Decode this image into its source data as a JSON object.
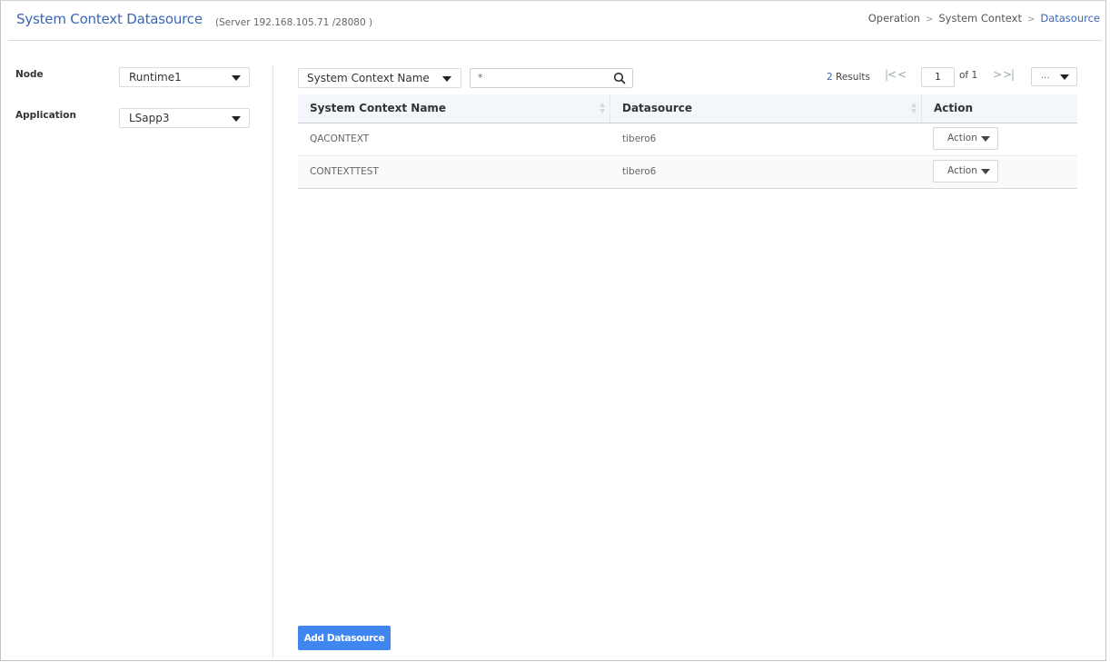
{
  "header": {
    "title": "System Context Datasource",
    "server_info": "(Server 192.168.105.71 /28080 )",
    "breadcrumb": [
      "Operation",
      "System Context",
      "Datasource"
    ]
  },
  "filters": {
    "node": {
      "label": "Node",
      "value": "Runtime1"
    },
    "application": {
      "label": "Application",
      "value": "LSapp3"
    }
  },
  "toolbar": {
    "search_field_select": "System Context Name",
    "search_value": "*",
    "results_count": "2",
    "results_label": "Results",
    "first_page_icon": "|<",
    "prev_page_icon": "<",
    "current_page": "1",
    "page_of": "of 1",
    "next_page_icon": ">",
    "last_page_icon": ">|",
    "more_label": "..."
  },
  "table": {
    "columns": [
      "System Context Name",
      "Datasource",
      "Action"
    ],
    "rows": [
      {
        "name": "QACONTEXT",
        "datasource": "tibero6",
        "action": "Action"
      },
      {
        "name": "CONTEXTTEST",
        "datasource": "tibero6",
        "action": "Action"
      }
    ]
  },
  "footer": {
    "add_button": "Add Datasource"
  },
  "colors": {
    "accent": "#3a66b5",
    "primary_button": "#3f86f0"
  }
}
